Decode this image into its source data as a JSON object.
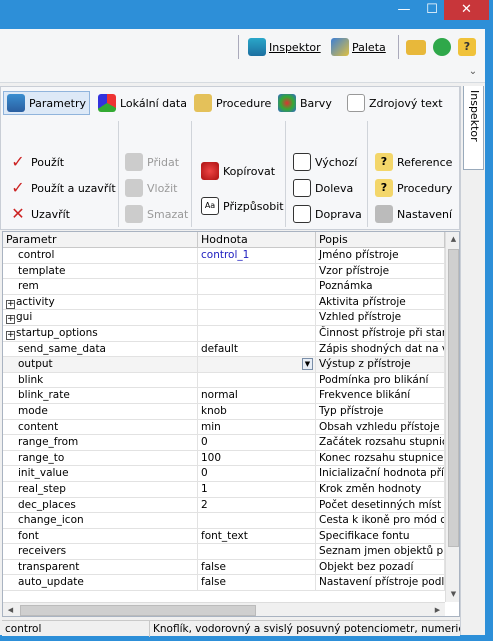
{
  "window": {
    "minimize": "—",
    "maximize": "☐",
    "close": "✕"
  },
  "topbar": {
    "inspector_label": "Inspektor",
    "palette_label": "Paleta"
  },
  "ribbon": {
    "tabs": [
      "Parametry",
      "Lokální data",
      "Procedure",
      "Barvy",
      "Zdrojový text"
    ],
    "group1": [
      "Použít",
      "Použít a uzavřít",
      "Uzavřít"
    ],
    "group2": [
      "Přidat",
      "Vložit",
      "Smazat"
    ],
    "group3": [
      "Kopírovat",
      "Přizpůsobit"
    ],
    "group4": [
      "Výchozí",
      "Doleva",
      "Doprava"
    ],
    "group5": [
      "Reference",
      "Procedury",
      "Nastavení"
    ]
  },
  "side_tab": "Inspektor",
  "grid": {
    "headers": [
      "Parametr",
      "Hodnota",
      "Popis"
    ],
    "rows": [
      {
        "param": "control",
        "value": "control_1",
        "desc": "Jméno přístroje"
      },
      {
        "param": "template",
        "value": "",
        "desc": "Vzor přístroje"
      },
      {
        "param": "rem",
        "value": "",
        "desc": "Poznámka"
      },
      {
        "param": "activity",
        "value": "",
        "desc": "Aktivita přístroje"
      },
      {
        "param": "gui",
        "value": "",
        "desc": "Vzhled přístroje"
      },
      {
        "param": "startup_options",
        "value": "",
        "desc": "Činnost přístroje při startu"
      },
      {
        "param": "send_same_data",
        "value": "default",
        "desc": "Zápis shodných dat na výstup"
      },
      {
        "param": "output",
        "value": "",
        "desc": "Výstup z přístroje"
      },
      {
        "param": "blink",
        "value": "",
        "desc": "Podmínka pro blikání"
      },
      {
        "param": "blink_rate",
        "value": "normal",
        "desc": "Frekvence blikání"
      },
      {
        "param": "mode",
        "value": "knob",
        "desc": "Typ přístroje"
      },
      {
        "param": "content",
        "value": "min",
        "desc": "Obsah vzhledu přístoje"
      },
      {
        "param": "range_from",
        "value": "0",
        "desc": "Začátek rozsahu stupnice"
      },
      {
        "param": "range_to",
        "value": "100",
        "desc": "Konec rozsahu stupnice"
      },
      {
        "param": "init_value",
        "value": "0",
        "desc": "Inicializační hodnota přístroje"
      },
      {
        "param": "real_step",
        "value": "1",
        "desc": "Krok změn hodnoty"
      },
      {
        "param": "dec_places",
        "value": "2",
        "desc": "Počet desetinných míst"
      },
      {
        "param": "change_icon",
        "value": "",
        "desc": "Cesta k ikoně pro mód change"
      },
      {
        "param": "font",
        "value": "font_text",
        "desc": "Specifikace fontu"
      },
      {
        "param": "receivers",
        "value": "",
        "desc": "Seznam jmen objektů příjímajících"
      },
      {
        "param": "transparent",
        "value": "false",
        "desc": "Objekt bez pozadí"
      },
      {
        "param": "auto_update",
        "value": "false",
        "desc": "Nastavení přístroje podle výstupu"
      }
    ]
  },
  "status": {
    "left": "control",
    "right": "Knoflík, vodorovný a svislý posuvný potenciometr, numerický řádek"
  }
}
